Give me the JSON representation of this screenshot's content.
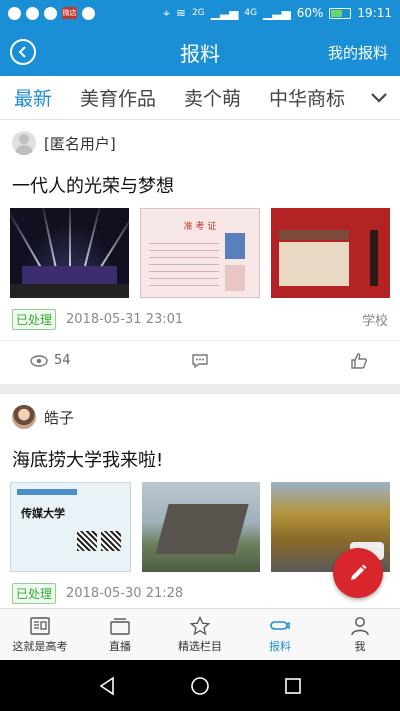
{
  "status_bar": {
    "net_speed": "2G",
    "network": "4G",
    "battery": "60%",
    "battery_level": 0.6,
    "time": "19:11",
    "notification_badge": "微店"
  },
  "header": {
    "title": "报料",
    "right_link": "我的报料"
  },
  "tabs": [
    {
      "label": "最新",
      "active": true
    },
    {
      "label": "美育作品",
      "active": false
    },
    {
      "label": "卖个萌",
      "active": false
    },
    {
      "label": "中华商标",
      "active": false
    }
  ],
  "posts": [
    {
      "user": "[匿名用户]",
      "title": "一代人的光荣与梦想",
      "ticket_caption": "准 考 证",
      "status": "已处理",
      "date": "2018-05-31 23:01",
      "category": "学校",
      "views": "54"
    },
    {
      "user": "皓子",
      "title": "海底捞大学我来啦!",
      "ticket_caption": "传媒大学",
      "status": "已处理",
      "date": "2018-05-30 21:28",
      "category": "",
      "views": ""
    }
  ],
  "bottom_nav": [
    {
      "label": "这就是高考",
      "icon": "newspaper-icon",
      "active": false
    },
    {
      "label": "直播",
      "icon": "tv-icon",
      "active": false
    },
    {
      "label": "精选栏目",
      "icon": "star-icon",
      "active": false
    },
    {
      "label": "报料",
      "icon": "megaphone-icon",
      "active": true
    },
    {
      "label": "我",
      "icon": "person-icon",
      "active": false
    }
  ],
  "colors": {
    "brand_blue": "#1a8fd6",
    "fab_red": "#d9262c",
    "status_green": "#3aa83a"
  }
}
